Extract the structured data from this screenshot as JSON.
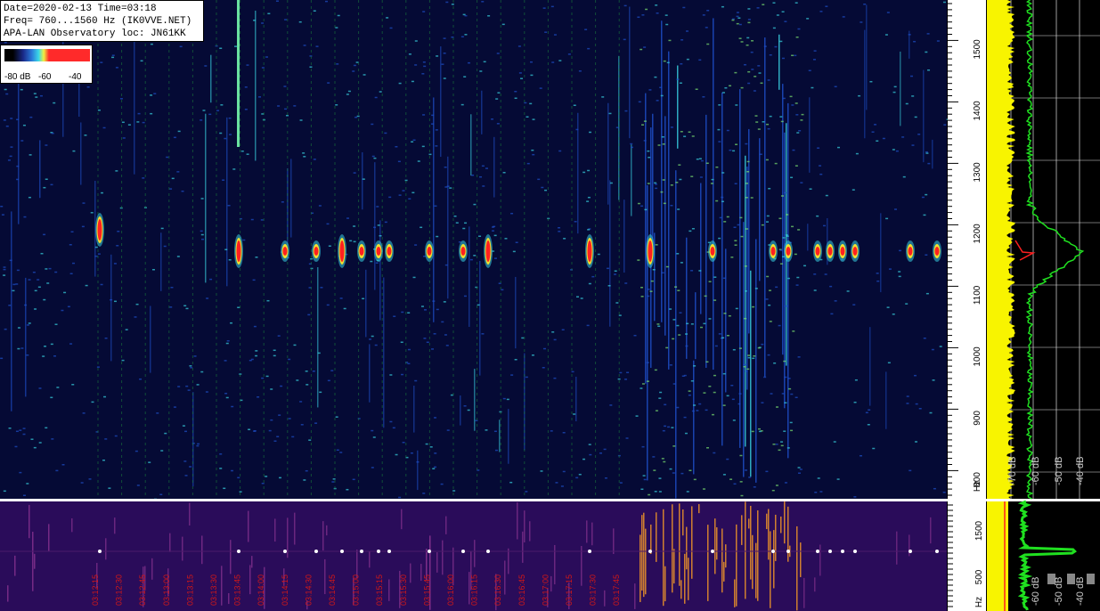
{
  "header": {
    "line1": "Date=2020-02-13 Time=03:18",
    "line2": "Freq= 760...1560 Hz (IK0VVE.NET)",
    "line3": "APA-LAN Observatory loc: JN61KK"
  },
  "colorbar": {
    "labels": [
      "-80 dB",
      "-60",
      "-40"
    ]
  },
  "colors": {
    "background": "#000000",
    "noise_blue": "#1e4fc8",
    "noise_cyan": "#38d0e0",
    "signal_red": "#ff2020",
    "spectrum_yellow": "#f8f400",
    "spectrum_green": "#20e020",
    "lower_panel_purple": "#2a0c5a",
    "lower_panel_orange": "#e8902a",
    "grid_green": "#1a7a3a",
    "time_label_red": "#d01818"
  },
  "chart_data": [
    {
      "type": "heatmap",
      "title": "",
      "ylabel": "Hz",
      "ylim": [
        760,
        1560
      ],
      "y_ticks": [
        "800",
        "900",
        "1000",
        "1100",
        "1200",
        "1300",
        "1400",
        "1500"
      ],
      "y_unit": "Hz",
      "grid": true
    },
    {
      "type": "line",
      "series": [
        {
          "values": []
        }
      ],
      "x_ticks": [
        "-70 dB",
        "-60 dB",
        "-50 dB",
        "-40 dB"
      ],
      "grid": true
    },
    {
      "type": "heatmap",
      "y_ticks": [
        "1500",
        "500",
        "Hz"
      ],
      "x_ticks": [
        "03:12:15",
        "03:12:30",
        "03:12:45",
        "03:13:00",
        "03:13:15",
        "03:13:30",
        "03:13:45",
        "03:14:00",
        "03:14:15",
        "03:14:30",
        "03:14:45",
        "03:15:00",
        "03:15:15",
        "03:15:30",
        "03:15:45",
        "03:16:00",
        "03:16:15",
        "03:16:30",
        "03:16:45",
        "03:17:00",
        "03:17:15",
        "03:17:30",
        "03:17:45"
      ],
      "spec_labels": [
        "-60 dB",
        "-50 dB",
        "-40 dB"
      ]
    }
  ]
}
